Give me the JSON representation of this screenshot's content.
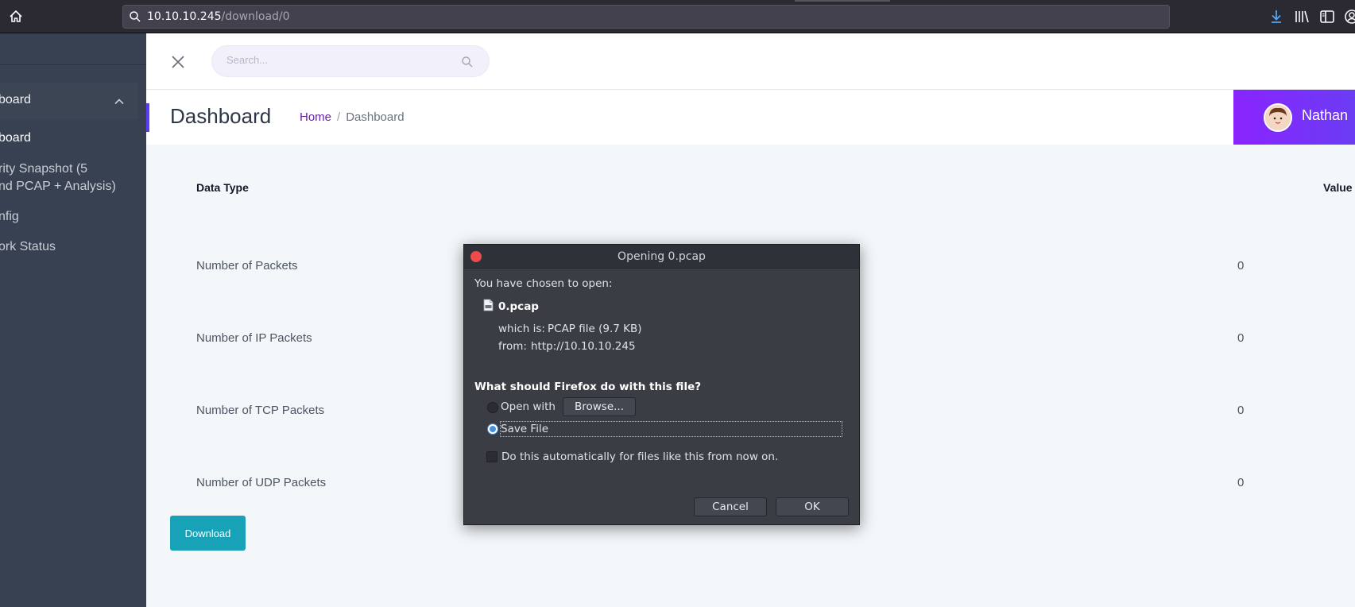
{
  "browser": {
    "url_host": "10.10.10.245",
    "url_path": "/download/0"
  },
  "sidebar": {
    "section_label": "board",
    "items": [
      {
        "label": "board"
      },
      {
        "label": "rity Snapshot (5"
      },
      {
        "label": "nd PCAP + Analysis)"
      },
      {
        "label": "nfig"
      },
      {
        "label": "ork Status"
      }
    ]
  },
  "header": {
    "search_placeholder": "Search..."
  },
  "page": {
    "title": "Dashboard",
    "breadcrumb": {
      "home": "Home",
      "separator": "/",
      "current": "Dashboard"
    },
    "user_name": "Nathan"
  },
  "table": {
    "header_type": "Data Type",
    "header_value": "Value",
    "rows": [
      {
        "label": "Number of Packets",
        "value": "0"
      },
      {
        "label": "Number of IP Packets",
        "value": "0"
      },
      {
        "label": "Number of TCP Packets",
        "value": "0"
      },
      {
        "label": "Number of UDP Packets",
        "value": "0"
      }
    ],
    "download_label": "Download"
  },
  "dialog": {
    "title": "Opening 0.pcap",
    "intro": "You have chosen to open:",
    "filename": "0.pcap",
    "which_is_label": "which is:",
    "which_is_value": "PCAP file (9.7 KB)",
    "from_label": "from:",
    "from_value": "http://10.10.10.245",
    "question": "What should Firefox do with this file?",
    "open_with": "Open with",
    "browse": "Browse...",
    "save_file": "Save File",
    "auto": "Do this automatically for files like this from now on.",
    "cancel": "Cancel",
    "ok": "OK"
  },
  "colors": {
    "sidebar": "#374151",
    "accent": "#8a24ff",
    "download_button": "#17a2b8"
  }
}
